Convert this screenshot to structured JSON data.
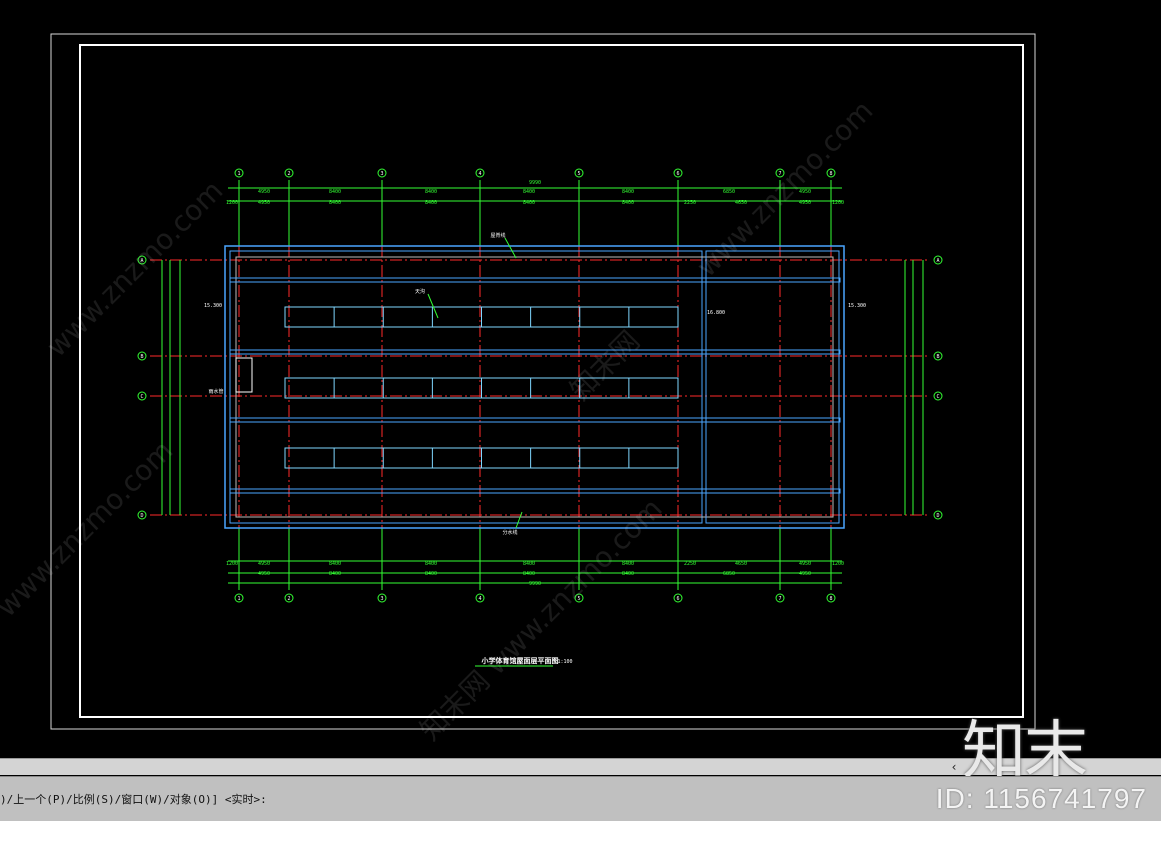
{
  "drawing": {
    "title": "小学体育馆屋面层平面图",
    "scale": "1:100",
    "total_dim": "9990",
    "top_dims_row1": [
      "4950",
      "8400",
      "8400",
      "8400",
      "8400",
      "6850",
      "4950"
    ],
    "top_dims_row2": [
      "1200",
      "4950",
      "8400",
      "8400",
      "8400",
      "8400",
      "2250",
      "4650",
      "4950",
      "1200"
    ],
    "bottom_dims_row1": [
      "1200",
      "4950",
      "8400",
      "8400",
      "8400",
      "8400",
      "2250",
      "4650",
      "4950",
      "1200"
    ],
    "bottom_dims_row2": [
      "4950",
      "8400",
      "8400",
      "8400",
      "8400",
      "6850",
      "4950"
    ],
    "axis_numbers": [
      "1",
      "2",
      "3",
      "4",
      "5",
      "6",
      "7",
      "8"
    ],
    "axis_letters": [
      "A",
      "B",
      "C",
      "D",
      "E"
    ],
    "roof_labels": [
      "屋脊线",
      "天沟",
      "雨水管",
      "分水线"
    ],
    "elevations": [
      "15.300",
      "15.300",
      "16.800"
    ]
  },
  "watermarks": [
    "www.znzmo.com",
    "知末网",
    "www.znzmo.com",
    "知末网 www.znzmo.com",
    "www.znzmo.com"
  ],
  "scrollbar": {
    "left_arrow": "‹"
  },
  "command_line": {
    "text": ")/上一个(P)/比例(S)/窗口(W)/对象(O)] <实时>:"
  },
  "branding": {
    "logo": "知末",
    "id_text": "ID: 1156741797"
  },
  "colors": {
    "frame": "#ffffff",
    "grid": "#ff2a2a",
    "dim": "#33ff33",
    "roof": "#4aa6ff",
    "panel": "#7fd7ff"
  }
}
